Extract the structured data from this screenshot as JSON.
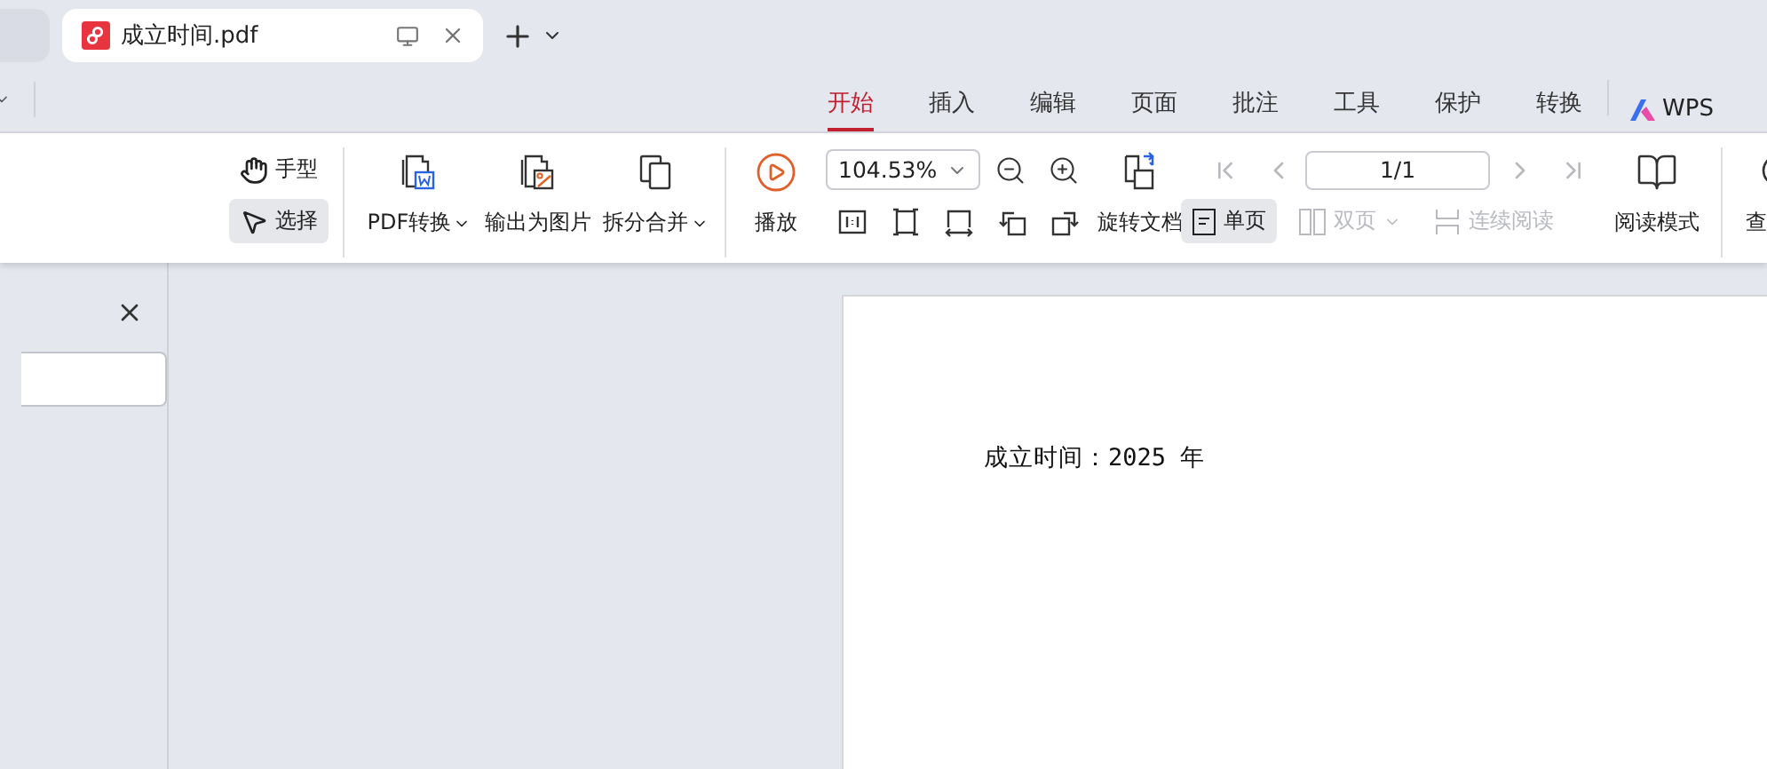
{
  "tabs": [
    {
      "kind": "blank",
      "selected": false
    },
    {
      "kind": "document",
      "title": "成立时间.pdf",
      "selected": true
    }
  ],
  "ribbon_tabs": [
    {
      "label": "开始",
      "selected": true
    },
    {
      "label": "插入",
      "selected": false
    },
    {
      "label": "编辑",
      "selected": false
    },
    {
      "label": "页面",
      "selected": false
    },
    {
      "label": "批注",
      "selected": false
    },
    {
      "label": "工具",
      "selected": false
    },
    {
      "label": "保护",
      "selected": false
    },
    {
      "label": "转换",
      "selected": false
    }
  ],
  "ai_label": "WPS",
  "toolbar": {
    "mouse_modes": [
      {
        "kind": "hand",
        "label": "手型",
        "selected": false
      },
      {
        "kind": "select",
        "label": "选择",
        "selected": true
      }
    ],
    "convert_buttons": [
      {
        "kind": "word",
        "label": "PDF转换",
        "dropdown": true
      },
      {
        "kind": "image",
        "label": "输出为图片",
        "dropdown": false
      },
      {
        "kind": "split",
        "label": "拆分合并",
        "dropdown": true
      }
    ],
    "play": {
      "label": "播放"
    },
    "zoom": {
      "value": "104.53%"
    },
    "rotate": {
      "label": "旋转文档"
    },
    "page": {
      "value": "1/1"
    },
    "view_modes": [
      {
        "kind": "single",
        "label": "单页",
        "selected": true,
        "disabled": false,
        "dropdown": false
      },
      {
        "kind": "double",
        "label": "双页",
        "selected": false,
        "disabled": true,
        "dropdown": true
      },
      {
        "kind": "continuous",
        "label": "连续阅读",
        "selected": false,
        "disabled": true,
        "dropdown": false
      }
    ],
    "reading_mode": {
      "label": "阅读模式"
    },
    "find": {
      "label": "查"
    }
  },
  "document": {
    "text": "成立时间：2025 年"
  }
}
